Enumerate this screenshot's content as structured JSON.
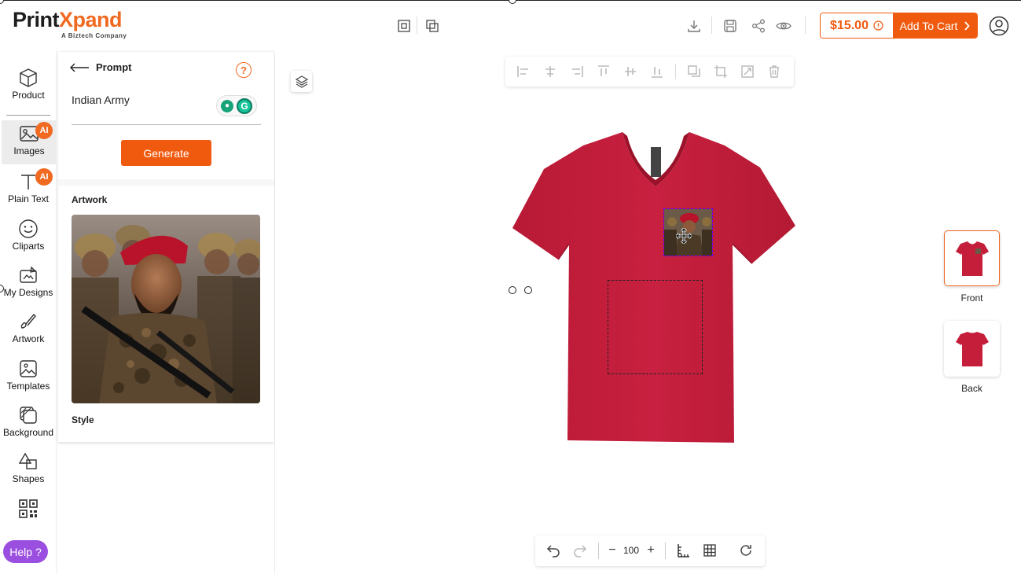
{
  "brand": {
    "name_part1": "Print",
    "name_part2": "Xpand",
    "tagline": "A Biztech Company",
    "accent": "#f06a22"
  },
  "header": {
    "price": "$15.00",
    "add_to_cart": "Add To Cart",
    "cart_color": "#f05a0e"
  },
  "nav": {
    "items": [
      {
        "label": "Product"
      },
      {
        "label": "Images",
        "badge": "AI"
      },
      {
        "label": "Plain Text",
        "badge": "AI"
      },
      {
        "label": "Cliparts"
      },
      {
        "label": "My Designs"
      },
      {
        "label": "Artwork"
      },
      {
        "label": "Templates"
      },
      {
        "label": "Background"
      },
      {
        "label": "Shapes"
      }
    ],
    "help": "Help ?"
  },
  "panel": {
    "back_title": "Prompt",
    "prompt_value": "Indian Army",
    "generate": "Generate",
    "artwork_label": "Artwork",
    "style_label": "Style"
  },
  "canvas": {
    "zoom": "100",
    "views": [
      {
        "label": "Front"
      },
      {
        "label": "Back"
      }
    ],
    "shirt_color": "#c41e3a"
  }
}
